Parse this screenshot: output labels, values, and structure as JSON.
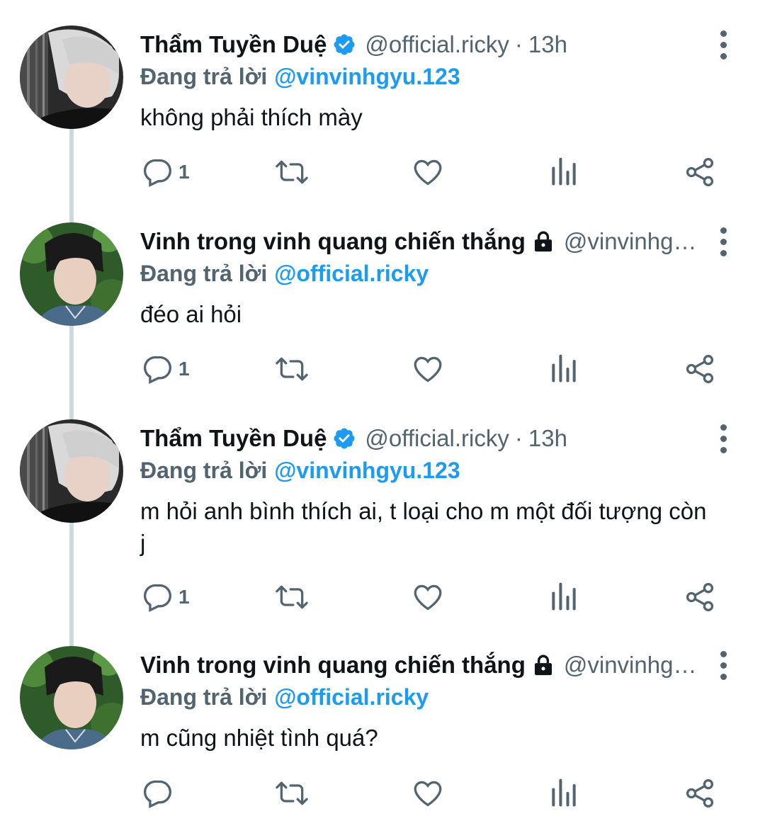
{
  "tweets": [
    {
      "name": "Thẩm Tuyền Duệ",
      "verified": true,
      "handle": "@official.ricky",
      "dot": "·",
      "time": "13h",
      "replying_label": "Đang trả lời",
      "replying_to": "@vinvinhgyu.123",
      "text": "không phải thích mày",
      "reply_count": "1",
      "avatar": "grey-haired-person"
    },
    {
      "name": "Vinh trong vinh quang chiến thắng",
      "verified": false,
      "lock": true,
      "handle": "@vinvinhg…",
      "replying_label": "Đang trả lời",
      "replying_to": "@official.ricky",
      "text": "đéo ai hỏi",
      "reply_count": "1",
      "avatar": "dark-haired-person"
    },
    {
      "name": "Thẩm Tuyền Duệ",
      "verified": true,
      "handle": "@official.ricky",
      "dot": "·",
      "time": "13h",
      "replying_label": "Đang trả lời",
      "replying_to": "@vinvinhgyu.123",
      "text": "m hỏi anh bình thích ai, t loại cho m một đối tượng còn j",
      "reply_count": "1",
      "avatar": "grey-haired-person"
    },
    {
      "name": "Vinh trong vinh quang chiến thắng",
      "verified": false,
      "lock": true,
      "handle": "@vinvinhg…",
      "replying_label": "Đang trả lời",
      "replying_to": "@official.ricky",
      "text": "m cũng nhiệt tình quá?",
      "reply_count": "",
      "avatar": "dark-haired-person"
    }
  ],
  "icons": {
    "reply": "speech-bubble-icon",
    "retweet": "retweet-icon",
    "like": "heart-icon",
    "views": "bar-chart-icon",
    "share": "share-icon",
    "more": "vertical-ellipsis-icon",
    "verified": "verified-badge-icon",
    "lock": "lock-icon"
  },
  "colors": {
    "accent": "#1d9bf0",
    "muted": "#536471",
    "text": "#0f1419",
    "thread_line": "#cfd9de"
  }
}
